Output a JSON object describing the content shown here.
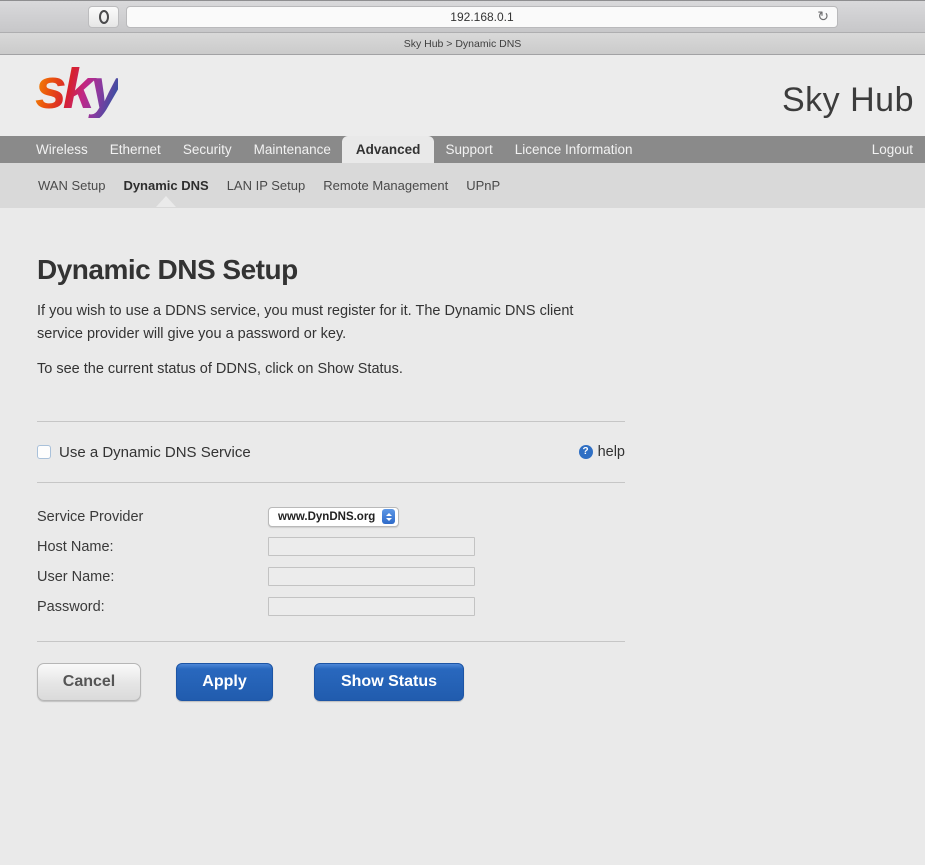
{
  "browser": {
    "url": "192.168.0.1",
    "tab_title": "Sky Hub > Dynamic DNS",
    "refresh_glyph": "↻"
  },
  "header": {
    "logo_text": "sky",
    "title": "Sky Hub"
  },
  "nav": {
    "items": [
      {
        "label": "Wireless",
        "active": false
      },
      {
        "label": "Ethernet",
        "active": false
      },
      {
        "label": "Security",
        "active": false
      },
      {
        "label": "Maintenance",
        "active": false
      },
      {
        "label": "Advanced",
        "active": true
      },
      {
        "label": "Support",
        "active": false
      },
      {
        "label": "Licence Information",
        "active": false
      }
    ],
    "logout_label": "Logout"
  },
  "subnav": {
    "items": [
      {
        "label": "WAN Setup",
        "active": false
      },
      {
        "label": "Dynamic DNS",
        "active": true
      },
      {
        "label": "LAN IP Setup",
        "active": false
      },
      {
        "label": "Remote Management",
        "active": false
      },
      {
        "label": "UPnP",
        "active": false
      }
    ]
  },
  "page": {
    "title": "Dynamic DNS Setup",
    "intro_1": "If you wish to use a DDNS service, you must register for it. The Dynamic DNS client service provider will give you a password or key.",
    "intro_2": "To see the current status of DDNS, click on Show Status.",
    "checkbox_label": "Use a Dynamic DNS Service",
    "help_icon_glyph": "?",
    "help_label": "help",
    "form": {
      "service_provider_label": "Service Provider",
      "service_provider_value": "www.DynDNS.org",
      "host_name_label": "Host Name:",
      "user_name_label": "User Name:",
      "password_label": "Password:",
      "host_name_value": "",
      "user_name_value": "",
      "password_value": ""
    },
    "buttons": {
      "cancel": "Cancel",
      "apply": "Apply",
      "show_status": "Show Status"
    }
  },
  "colors": {
    "accent_blue": "#2663b8",
    "help_blue": "#2f6fc4",
    "nav_gray": "#8a8a8a",
    "page_bg": "#eaeaea"
  }
}
